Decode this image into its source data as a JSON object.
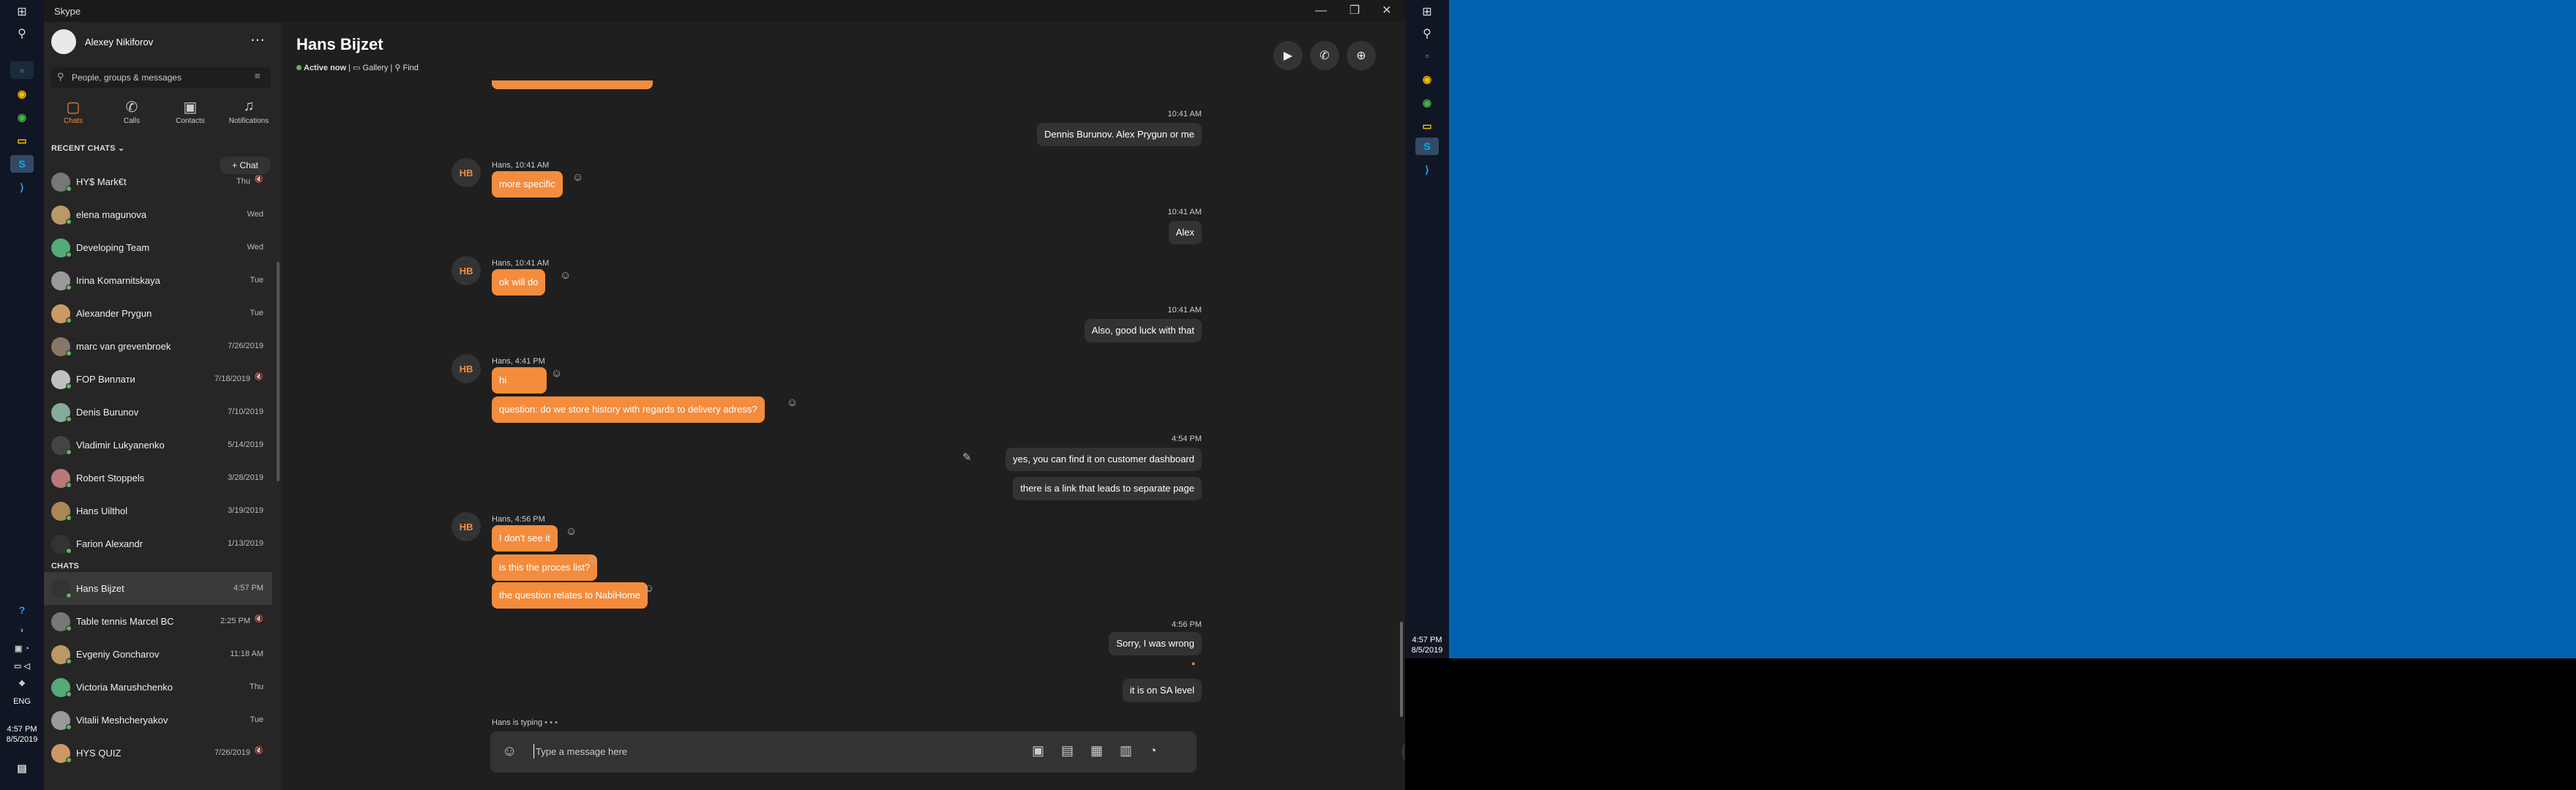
{
  "window": {
    "title": "Skype"
  },
  "profile": {
    "name": "Alexey Nikiforov"
  },
  "search": {
    "placeholder": "People, groups & messages"
  },
  "nav": [
    {
      "label": "Chats",
      "icon": "chat-icon",
      "active": true
    },
    {
      "label": "Calls",
      "icon": "phone-icon"
    },
    {
      "label": "Contacts",
      "icon": "contacts-icon"
    },
    {
      "label": "Notifications",
      "icon": "bell-icon"
    }
  ],
  "recent_title": "RECENT CHATS",
  "new_chat_label": "+ Chat",
  "recent": [
    {
      "name": "HY$ Mark€t",
      "time": "Thu",
      "muted": true
    },
    {
      "name": "elena magunova",
      "time": "Wed"
    },
    {
      "name": "Developing Team",
      "time": "Wed"
    },
    {
      "name": "Irina Komarnitskaya",
      "time": "Tue"
    },
    {
      "name": "Alexander Prygun",
      "time": "Tue"
    },
    {
      "name": "marc van grevenbroek",
      "time": "7/26/2019"
    },
    {
      "name": "FOP Виплати",
      "time": "7/18/2019",
      "muted": true
    },
    {
      "name": "Denis Burunov",
      "time": "7/10/2019"
    },
    {
      "name": "Vladimir Lukyanenko",
      "time": "5/14/2019"
    },
    {
      "name": "Robert Stoppels",
      "time": "3/28/2019"
    },
    {
      "name": "Hans Uilthol",
      "time": "3/19/2019"
    },
    {
      "name": "Farion Alexandr",
      "time": "1/13/2019"
    }
  ],
  "chats_title": "CHATS",
  "chats": [
    {
      "name": "Hans Bijzet",
      "time": "4:57 PM",
      "active": true
    },
    {
      "name": "Table tennis Marcel BC",
      "time": "2:25 PM",
      "muted": true
    },
    {
      "name": "Evgeniy Goncharov",
      "time": "11:18 AM"
    },
    {
      "name": "Victoria Marushchenko",
      "time": "Thu"
    },
    {
      "name": "Vitalii Meshcheryakov",
      "time": "Tue"
    },
    {
      "name": "HYS QUIZ",
      "time": "7/26/2019",
      "muted": true
    }
  ],
  "header": {
    "name": "Hans Bijzet",
    "status": "Active now",
    "gallery": "Gallery",
    "find": "Find"
  },
  "messages": {
    "m1_time": "10:41 AM",
    "m1_text": "Dennis Burunov. Alex Prygun or me",
    "hb_initials": "HB",
    "m2_sender": "Hans, 10:41 AM",
    "m2_text": "more specific",
    "m3_time": "10:41 AM",
    "m3_text": "Alex",
    "m4_sender": "Hans, 10:41 AM",
    "m4_text": "ok will do",
    "m5_time": "10:41 AM",
    "m5_text": "Also, good luck with that",
    "m6_sender": "Hans, 4:41 PM",
    "m6_text": "hi",
    "m6b_text": "question: do we store history with regards to delivery adress?",
    "m7_time": "4:54 PM",
    "m7_text": "yes, you can find it on customer dashboard",
    "m7b_text": "there is a link that leads to separate page",
    "m8_sender": "Hans, 4:56 PM",
    "m8_text": "I don't see it",
    "m8b_text": "is this the proces list?",
    "m8c_text": "the question relates to NabiHome",
    "m9_time": "4:56 PM",
    "m9_text": "Sorry, I was wrong",
    "m9b_text": "it is on SA level"
  },
  "composer": {
    "typing": "Hans is typing",
    "placeholder": "Type a message here"
  },
  "taskbar": {
    "lang": "ENG",
    "time": "4:57 PM",
    "date": "8/5/2019"
  },
  "colors": {
    "accent": "#f38c3d",
    "online": "#5cb85c",
    "desktop": "#0063b1"
  }
}
